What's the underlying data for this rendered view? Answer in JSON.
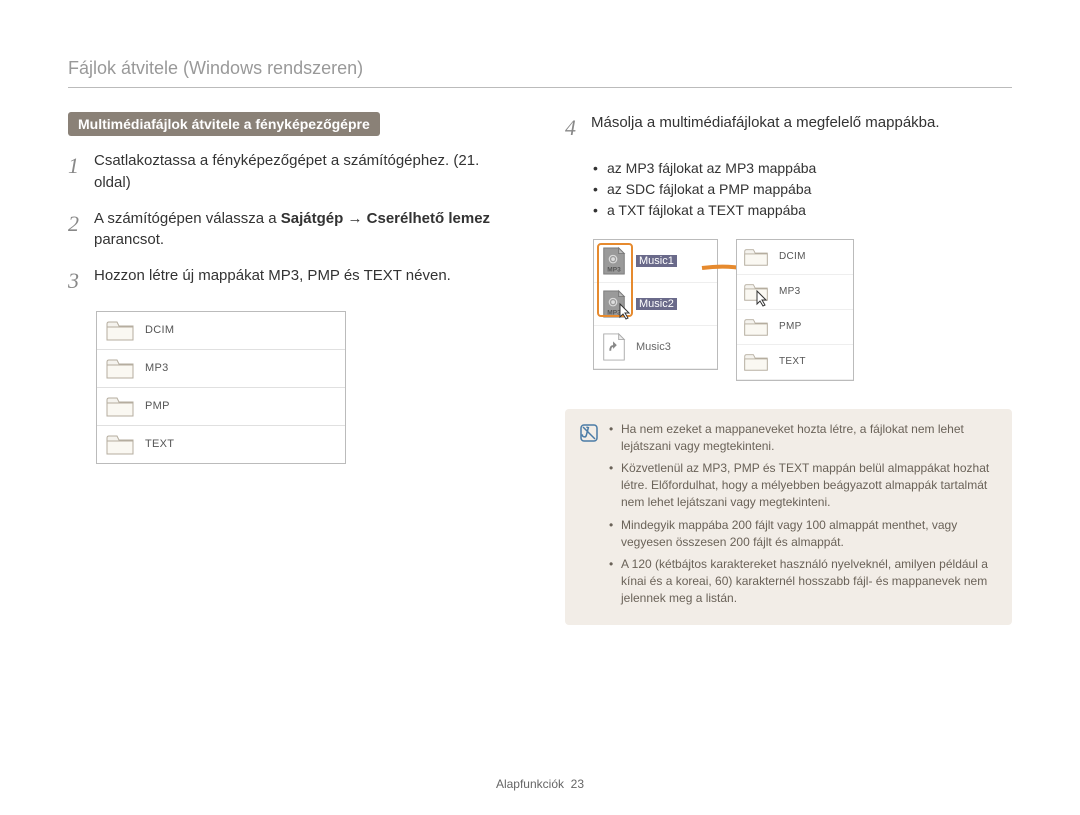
{
  "page_title": "Fájlok átvitele (Windows rendszeren)",
  "section_header": "Multimédiafájlok átvitele a fényképezőgépre",
  "steps": {
    "s1": {
      "num": "1",
      "text": "Csatlakoztassa a fényképezőgépet a számítógéphez. (21. oldal)"
    },
    "s2": {
      "num": "2",
      "prefix": "A számítógépen válassza a ",
      "bold1": "Sajátgép",
      "arrow": " → ",
      "bold2": "Cserélhető lemez",
      "suffix": " parancsot."
    },
    "s3": {
      "num": "3",
      "text": "Hozzon létre új mappákat MP3, PMP és TEXT néven."
    },
    "s4": {
      "num": "4",
      "text": "Másolja a multimédiafájlokat a megfelelő mappákba."
    }
  },
  "left_folders": [
    "DCIM",
    "MP3",
    "PMP",
    "TEXT"
  ],
  "right_bullets": [
    "az MP3 fájlokat az MP3 mappába",
    "az SDC fájlokat a PMP mappába",
    "a TXT fájlokat a TEXT mappába"
  ],
  "src_files": [
    {
      "label": "Music1",
      "selected": true
    },
    {
      "label": "Music2",
      "selected": true
    },
    {
      "label": "Music3",
      "selected": false
    }
  ],
  "dst_folders": [
    "DCIM",
    "MP3",
    "PMP",
    "TEXT"
  ],
  "notes": [
    "Ha nem ezeket a mappaneveket hozta létre, a fájlokat nem lehet lejátszani vagy megtekinteni.",
    "Közvetlenül az MP3, PMP és TEXT mappán belül almappákat hozhat létre. Előfordulhat, hogy a mélyebben beágyazott almappák tartalmát nem lehet lejátszani vagy megtekinteni.",
    "Mindegyik mappába 200 fájlt vagy 100 almappát menthet, vagy vegyesen összesen 200 fájlt és almappát.",
    "A 120 (kétbájtos karaktereket használó nyelveknél, amilyen például a kínai és a koreai, 60) karakternél hosszabb fájl- és mappanevek nem jelennek meg a listán."
  ],
  "footer": {
    "label": "Alapfunkciók",
    "page": "23"
  }
}
